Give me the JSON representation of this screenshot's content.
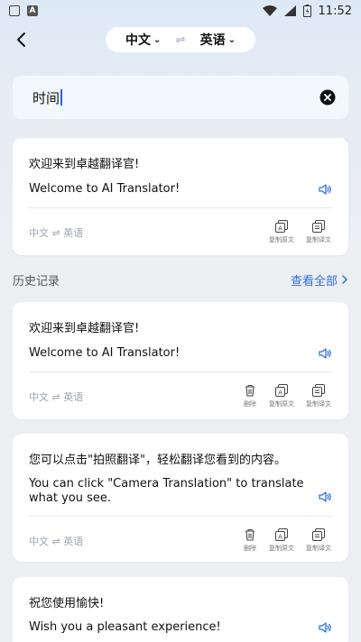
{
  "status_bar": {
    "time": "11:52"
  },
  "header": {
    "source_lang": "中文",
    "target_lang": "英语",
    "swap_symbol": "⇌"
  },
  "input": {
    "value": "时间"
  },
  "current": {
    "source": "欢迎来到卓越翻译官!",
    "target": "Welcome to AI Translator!",
    "pair": "中文 ⇌ 英语",
    "copy_source": "复制原文",
    "copy_target": "复制译文"
  },
  "history": {
    "title": "历史记录",
    "view_all": "查看全部",
    "items": [
      {
        "source": "欢迎来到卓越翻译官!",
        "target": "Welcome to AI Translator!",
        "pair": "中文 ⇌ 英语",
        "delete": "删除",
        "copy_source": "复制原文",
        "copy_target": "复制译文"
      },
      {
        "source": "您可以点击\"拍照翻译\"，轻松翻译您看到的内容。",
        "target": "You can click \"Camera Translation\" to translate what you see.",
        "pair": "中文 ⇌ 英语",
        "delete": "删除",
        "copy_source": "复制原文",
        "copy_target": "复制译文"
      },
      {
        "source": "祝您使用愉快!",
        "target": "Wish you a pleasant experience!"
      }
    ]
  },
  "colors": {
    "accent": "#2f6fe0",
    "muted": "#9ca3af"
  }
}
